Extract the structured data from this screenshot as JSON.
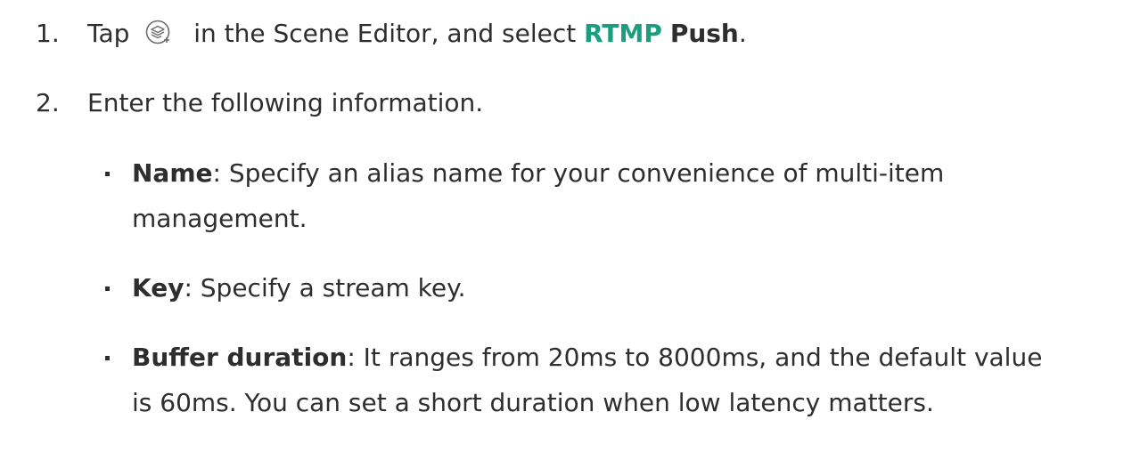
{
  "steps": [
    {
      "number": "1.",
      "prefix": "Tap",
      "icon": "scene-add-layer-icon",
      "middle": "in the Scene Editor, and select",
      "accent_word": "RTMP",
      "bold_word": "Push",
      "suffix": "."
    },
    {
      "number": "2.",
      "text": "Enter the following information."
    }
  ],
  "bullets": [
    {
      "label": "Name",
      "line1": ": Specify an alias name for your convenience of multi-item",
      "line2": "management."
    },
    {
      "label": "Key",
      "line1": ": Specify a stream key."
    },
    {
      "label": "Buffer duration",
      "line1": ": It ranges from 20ms to 8000ms, and the default value",
      "line2": "is 60ms. You can set a short duration when low latency matters."
    }
  ],
  "colors": {
    "text": "#2e2e2e",
    "accent": "#1a9e7e"
  }
}
